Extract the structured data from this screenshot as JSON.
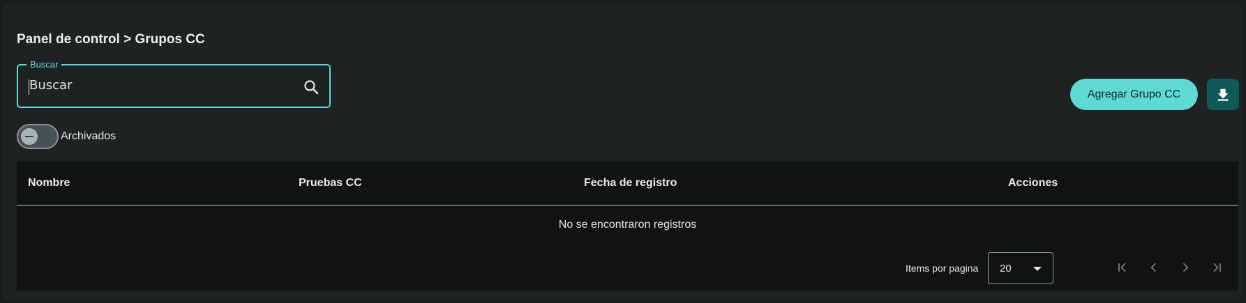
{
  "breadcrumb": "Panel de control > Grupos CC",
  "search": {
    "label": "Buscar",
    "value": "Buscar"
  },
  "toggle": {
    "label": "Archivados",
    "checked": false
  },
  "toolbar": {
    "add_label": "Agregar Grupo CC",
    "download_icon": "download-icon"
  },
  "table": {
    "columns": [
      "Nombre",
      "Pruebas CC",
      "Fecha de registro",
      "Acciones"
    ],
    "empty_message": "No se encontraron registros"
  },
  "pagination": {
    "items_label": "Items por pagina",
    "page_size": "20",
    "icons": [
      "first-page-icon",
      "previous-page-icon",
      "next-page-icon",
      "last-page-icon"
    ]
  },
  "colors": {
    "accent": "#5fd9d3",
    "download_bg": "#0e5a58",
    "background": "#1e2223",
    "table_bg": "#101213"
  }
}
